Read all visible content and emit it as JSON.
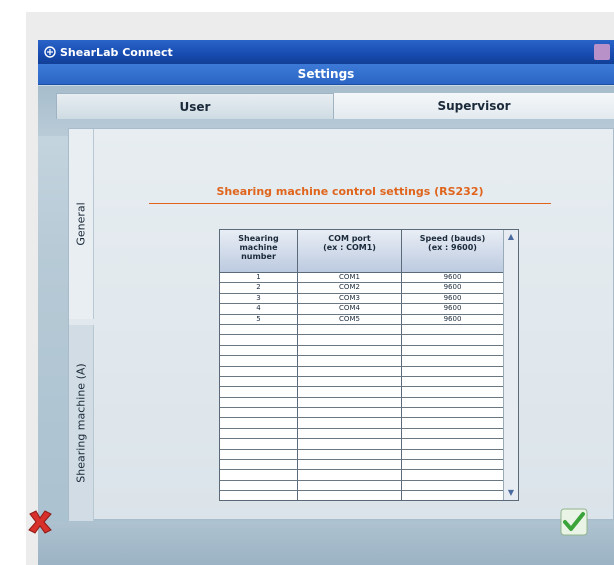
{
  "window": {
    "app_title": "ShearLab Connect",
    "header_title": "Settings"
  },
  "tabs": [
    {
      "label": "User",
      "active": false
    },
    {
      "label": "Supervisor",
      "active": true
    }
  ],
  "side_tabs": [
    {
      "label": "General",
      "active": true
    },
    {
      "label": "Shearing machine (A)",
      "active": false
    }
  ],
  "section": {
    "title": "Shearing machine control settings (RS232)"
  },
  "table": {
    "headers": [
      [
        "Shearing",
        "machine",
        "number"
      ],
      [
        "COM port",
        "(ex : COM1)"
      ],
      [
        "Speed (bauds)",
        "(ex : 9600)"
      ]
    ],
    "rows": [
      [
        "1",
        "COM1",
        "9600"
      ],
      [
        "2",
        "COM2",
        "9600"
      ],
      [
        "3",
        "COM3",
        "9600"
      ],
      [
        "4",
        "COM4",
        "9600"
      ],
      [
        "5",
        "COM5",
        "9600"
      ],
      [
        "",
        "",
        ""
      ],
      [
        "",
        "",
        ""
      ],
      [
        "",
        "",
        ""
      ],
      [
        "",
        "",
        ""
      ],
      [
        "",
        "",
        ""
      ],
      [
        "",
        "",
        ""
      ],
      [
        "",
        "",
        ""
      ],
      [
        "",
        "",
        ""
      ],
      [
        "",
        "",
        ""
      ],
      [
        "",
        "",
        ""
      ],
      [
        "",
        "",
        ""
      ],
      [
        "",
        "",
        ""
      ],
      [
        "",
        "",
        ""
      ],
      [
        "",
        "",
        ""
      ],
      [
        "",
        "",
        ""
      ],
      [
        "",
        "",
        ""
      ],
      [
        "",
        "",
        ""
      ]
    ]
  },
  "actions": {
    "cancel_icon": "red-x-icon",
    "ok_icon": "green-check-icon"
  },
  "colors": {
    "accent": "#e0641c",
    "titlebar": "#174bb0",
    "cancel": "#d8302a",
    "ok": "#3aa43a"
  }
}
